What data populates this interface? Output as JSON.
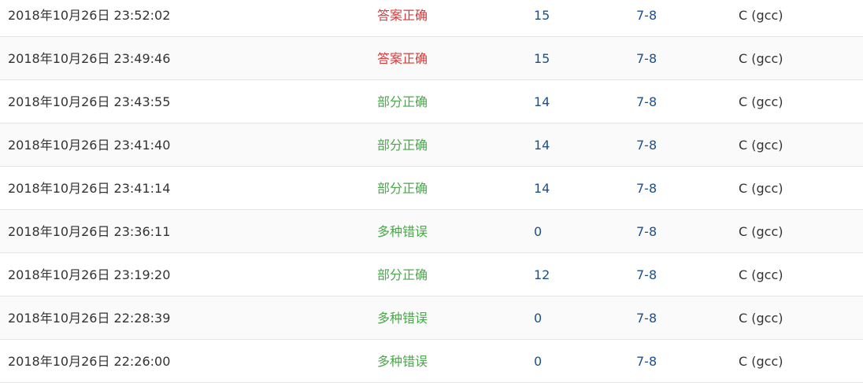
{
  "colors": {
    "accepted": "#d63a3a",
    "partial": "#4ca74c",
    "multiple_errors": "#4ca74c",
    "link": "#1c4f8c"
  },
  "rows": [
    {
      "time": "2018年10月26日 23:52:02",
      "status": "答案正确",
      "status_type": "accepted",
      "score": "15",
      "problem": "7-8",
      "lang": "C (gcc)"
    },
    {
      "time": "2018年10月26日 23:49:46",
      "status": "答案正确",
      "status_type": "accepted",
      "score": "15",
      "problem": "7-8",
      "lang": "C (gcc)"
    },
    {
      "time": "2018年10月26日 23:43:55",
      "status": "部分正确",
      "status_type": "partial",
      "score": "14",
      "problem": "7-8",
      "lang": "C (gcc)"
    },
    {
      "time": "2018年10月26日 23:41:40",
      "status": "部分正确",
      "status_type": "partial",
      "score": "14",
      "problem": "7-8",
      "lang": "C (gcc)"
    },
    {
      "time": "2018年10月26日 23:41:14",
      "status": "部分正确",
      "status_type": "partial",
      "score": "14",
      "problem": "7-8",
      "lang": "C (gcc)"
    },
    {
      "time": "2018年10月26日 23:36:11",
      "status": "多种错误",
      "status_type": "multiple_errors",
      "score": "0",
      "problem": "7-8",
      "lang": "C (gcc)"
    },
    {
      "time": "2018年10月26日 23:19:20",
      "status": "部分正确",
      "status_type": "partial",
      "score": "12",
      "problem": "7-8",
      "lang": "C (gcc)"
    },
    {
      "time": "2018年10月26日 22:28:39",
      "status": "多种错误",
      "status_type": "multiple_errors",
      "score": "0",
      "problem": "7-8",
      "lang": "C (gcc)"
    },
    {
      "time": "2018年10月26日 22:26:00",
      "status": "多种错误",
      "status_type": "multiple_errors",
      "score": "0",
      "problem": "7-8",
      "lang": "C (gcc)"
    }
  ]
}
